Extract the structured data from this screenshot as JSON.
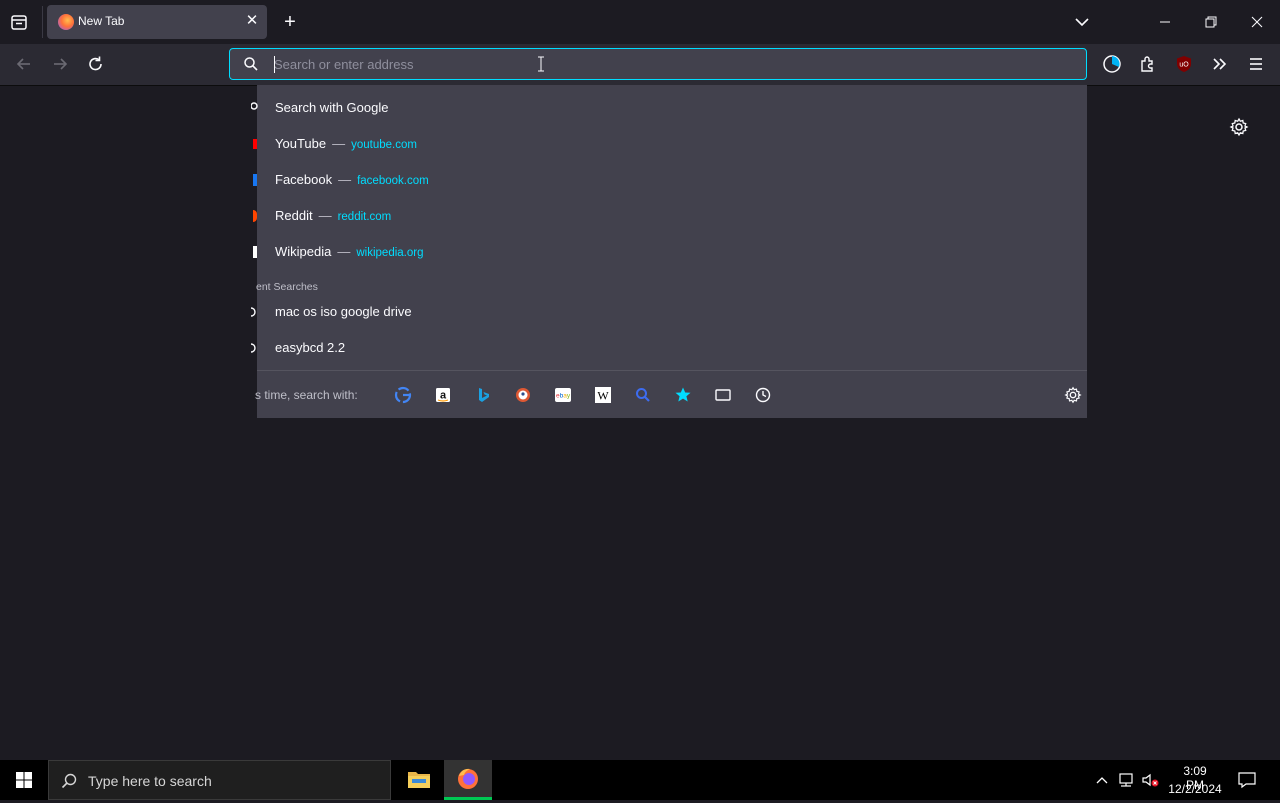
{
  "tab": {
    "title": "New Tab",
    "close": "✕"
  },
  "new_tab": "+",
  "urlbar": {
    "placeholder": "Search or enter address"
  },
  "dropdown": {
    "rows": [
      {
        "label": "Search with Google",
        "url": ""
      },
      {
        "label": "YouTube",
        "dash": "—",
        "url": "youtube.com",
        "icon_color": "#ff0000"
      },
      {
        "label": "Facebook",
        "dash": "—",
        "url": "facebook.com",
        "icon_color": "#1877f2"
      },
      {
        "label": "Reddit",
        "dash": "—",
        "url": "reddit.com",
        "icon_color": "#ff4500"
      },
      {
        "label": "Wikipedia",
        "dash": "—",
        "url": "wikipedia.org",
        "icon_color": "#ffffff"
      }
    ],
    "section_header": "ent Searches",
    "recent": [
      {
        "label": "mac os iso google drive"
      },
      {
        "label": "easybcd 2.2"
      }
    ],
    "oneoff_label": "s time, search with:",
    "oneoff_icons": [
      "google-icon",
      "amazon-icon",
      "bing-icon",
      "duckduckgo-icon",
      "ebay-icon",
      "wikipedia-icon",
      "search-icon",
      "bookmarks-icon",
      "tabs-icon",
      "history-icon"
    ]
  },
  "taskbar": {
    "search_placeholder": "Type here to search",
    "time": "3:09 PM",
    "date": "12/2/2024"
  },
  "colors": {
    "accent": "#00ddff",
    "panel": "#42414d",
    "toolbar": "#2b2a33",
    "background": "#1c1b22"
  }
}
